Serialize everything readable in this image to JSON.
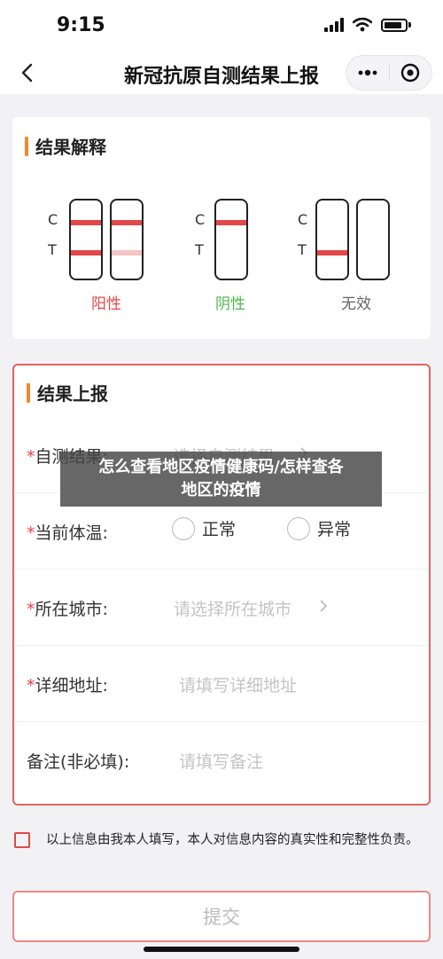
{
  "status_bar": {
    "time": "9:15"
  },
  "nav": {
    "title": "新冠抗原自测结果上报"
  },
  "interpretation": {
    "title": "结果解释",
    "c_label": "C",
    "t_label": "T",
    "groups": [
      {
        "label": "阳性",
        "color": "#e34848"
      },
      {
        "label": "阴性",
        "color": "#4cb84c"
      },
      {
        "label": "无效",
        "color": "#666666"
      }
    ]
  },
  "report": {
    "title": "结果上报",
    "fields": [
      {
        "required": "*",
        "label": "自测结果:",
        "placeholder": "选择自测结果"
      },
      {
        "required": "*",
        "label": "当前体温:",
        "options": [
          "正常",
          "异常"
        ]
      },
      {
        "required": "*",
        "label": "所在城市:",
        "placeholder": "请选择所在城市"
      },
      {
        "required": "*",
        "label": "详细地址:",
        "placeholder": "请填写详细地址"
      },
      {
        "required": "",
        "label": "备注(非必填):",
        "placeholder": "请填写备注"
      }
    ]
  },
  "agreement": {
    "text": "以上信息由我本人填写，本人对信息内容的真实性和完整性负责。"
  },
  "submit": {
    "label": "提交"
  },
  "overlay": {
    "line1": "怎么查看地区疫情健康码/怎样查各",
    "line2": "地区的疫情"
  },
  "colors": {
    "accent": "#f08a2e",
    "positive_red": "#e34848",
    "faint_red": "#f6c4c4",
    "negative_green": "#4cb84c"
  }
}
